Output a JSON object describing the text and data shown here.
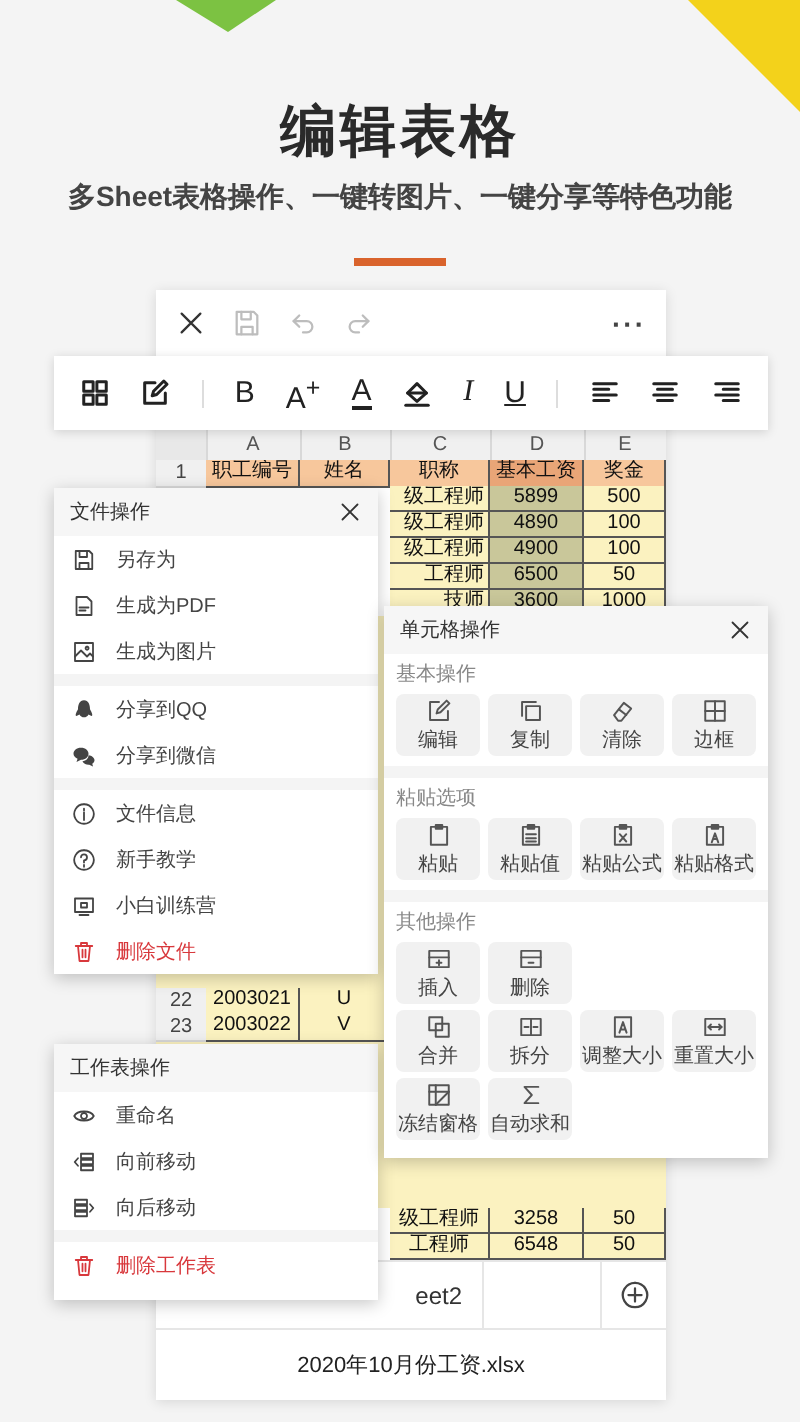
{
  "heading": {
    "title": "编辑表格",
    "subtitle": "多Sheet表格操作、一键转图片、一键分享等特色功能"
  },
  "top_bar": {
    "buttons": [
      {
        "kind": "close",
        "disabled": false
      },
      {
        "kind": "save",
        "disabled": true
      },
      {
        "kind": "undo",
        "disabled": true
      },
      {
        "kind": "redo",
        "disabled": true
      }
    ],
    "more": "···"
  },
  "format_toolbar": [
    {
      "kind": "grid"
    },
    {
      "kind": "edit"
    },
    {
      "kind": "divider"
    },
    {
      "kind": "bold",
      "label": "B"
    },
    {
      "kind": "size",
      "label": "A$^{+}$"
    },
    {
      "kind": "color",
      "label": "A"
    },
    {
      "kind": "fill"
    },
    {
      "kind": "italic",
      "label": "I"
    },
    {
      "kind": "underline",
      "label": "U"
    },
    {
      "kind": "divider"
    },
    {
      "kind": "align_left"
    },
    {
      "kind": "align_center"
    },
    {
      "kind": "align_right"
    }
  ],
  "sheet": {
    "column_headers": [
      "A",
      "B",
      "C",
      "D",
      "E"
    ],
    "header_row": {
      "number": "1",
      "cells": [
        "职工编号",
        "姓名",
        "职称",
        "基本工资",
        "奖金"
      ]
    },
    "upper_rows": [
      [
        "级工程师",
        "5899",
        "500"
      ],
      [
        "级工程师",
        "4890",
        "100"
      ],
      [
        "级工程师",
        "4900",
        "100"
      ],
      [
        "工程师",
        "6500",
        "50"
      ],
      [
        "技师",
        "3600",
        "1000"
      ]
    ],
    "lower_left_rows": [
      {
        "number": "22",
        "cells": [
          "2003021",
          "U"
        ]
      },
      {
        "number": "23",
        "cells": [
          "2003022",
          "V"
        ]
      }
    ],
    "lower_right_rows": [
      [
        "级工程师",
        "3258",
        "50"
      ],
      [
        "工程师",
        "6548",
        "50"
      ]
    ],
    "tab": "eet2",
    "file_name": "2020年10月份工资.xlsx"
  },
  "file_menu": {
    "title": "文件操作",
    "groups": [
      [
        {
          "label": "另存为",
          "danger": false
        },
        {
          "label": "生成为PDF",
          "danger": false
        },
        {
          "label": "生成为图片",
          "danger": false
        }
      ],
      [
        {
          "label": "分享到QQ",
          "danger": false
        },
        {
          "label": "分享到微信",
          "danger": false
        }
      ],
      [
        {
          "label": "文件信息",
          "danger": false
        },
        {
          "label": "新手教学",
          "danger": false
        },
        {
          "label": "小白训练营",
          "danger": false
        },
        {
          "label": "删除文件",
          "danger": true
        }
      ]
    ]
  },
  "cell_menu": {
    "title": "单元格操作",
    "sections": [
      {
        "label": "基本操作",
        "rows": [
          [
            "编辑",
            "复制",
            "清除",
            "边框"
          ]
        ]
      },
      {
        "label": "粘贴选项",
        "rows": [
          [
            "粘贴",
            "粘贴值",
            "粘贴公式",
            "粘贴格式"
          ]
        ]
      },
      {
        "label": "其他操作",
        "rows": [
          [
            "插入",
            "删除"
          ],
          [
            "合并",
            "拆分",
            "调整大小",
            "重置大小"
          ],
          [
            "冻结窗格",
            "自动求和"
          ]
        ]
      }
    ]
  },
  "sheet_menu": {
    "title": "工作表操作",
    "groups": [
      [
        {
          "label": "重命名",
          "danger": false
        },
        {
          "label": "向前移动",
          "danger": false
        },
        {
          "label": "向后移动",
          "danger": false
        }
      ],
      [
        {
          "label": "删除工作表",
          "danger": true
        }
      ]
    ]
  }
}
